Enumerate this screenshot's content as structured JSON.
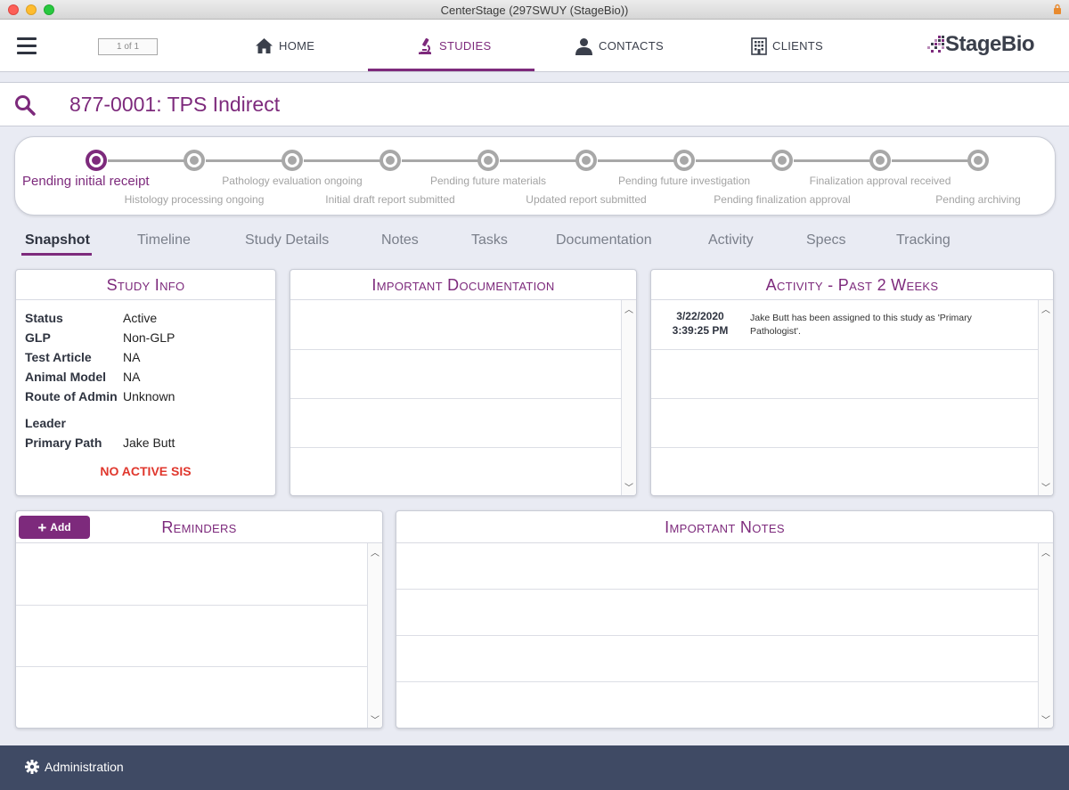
{
  "window": {
    "title": "CenterStage (297SWUY (StageBio))"
  },
  "nav": {
    "pager": "1 of 1",
    "items": [
      {
        "label": "HOME",
        "icon": "home-icon"
      },
      {
        "label": "STUDIES",
        "icon": "microscope-icon",
        "active": true
      },
      {
        "label": "CONTACTS",
        "icon": "person-icon"
      },
      {
        "label": "CLIENTS",
        "icon": "building-icon"
      }
    ],
    "logo": "StageBio"
  },
  "study": {
    "title": "877-0001: TPS Indirect"
  },
  "progress": {
    "current": "Pending initial receipt",
    "stages": [
      "Pending initial receipt",
      "Histology processing ongoing",
      "Pathology evaluation ongoing",
      "Initial draft report submitted",
      "Pending future materials",
      "Updated report submitted",
      "Pending future investigation",
      "Pending finalization approval",
      "Finalization approval received",
      "Pending archiving"
    ]
  },
  "tabs": [
    "Snapshot",
    "Timeline",
    "Study Details",
    "Notes",
    "Tasks",
    "Documentation",
    "Activity",
    "Specs",
    "Tracking"
  ],
  "study_info": {
    "title": "Study Info",
    "rows": [
      {
        "label": "Status",
        "value": "Active"
      },
      {
        "label": "GLP",
        "value": "Non-GLP"
      },
      {
        "label": "Test Article",
        "value": "NA"
      },
      {
        "label": "Animal Model",
        "value": "NA"
      },
      {
        "label": "Route of Admin",
        "value": "Unknown"
      },
      {
        "label": "Leader",
        "value": ""
      },
      {
        "label": "Primary Path",
        "value": "Jake Butt"
      }
    ],
    "alert": "NO ACTIVE SIS"
  },
  "important_documentation": {
    "title": "Important Documentation"
  },
  "activity": {
    "title": "Activity - Past 2 Weeks",
    "entries": [
      {
        "date": "3/22/2020",
        "time": "3:39:25 PM",
        "text": "Jake Butt has been assigned to this study as 'Primary Pathologist'."
      }
    ]
  },
  "reminders": {
    "title": "Reminders",
    "add_label": "Add"
  },
  "important_notes": {
    "title": "Important Notes"
  },
  "footer": {
    "admin_label": "Administration"
  },
  "colors": {
    "accent": "#7d2a7c",
    "footer": "#3f4a64",
    "alert": "#e0372d"
  }
}
